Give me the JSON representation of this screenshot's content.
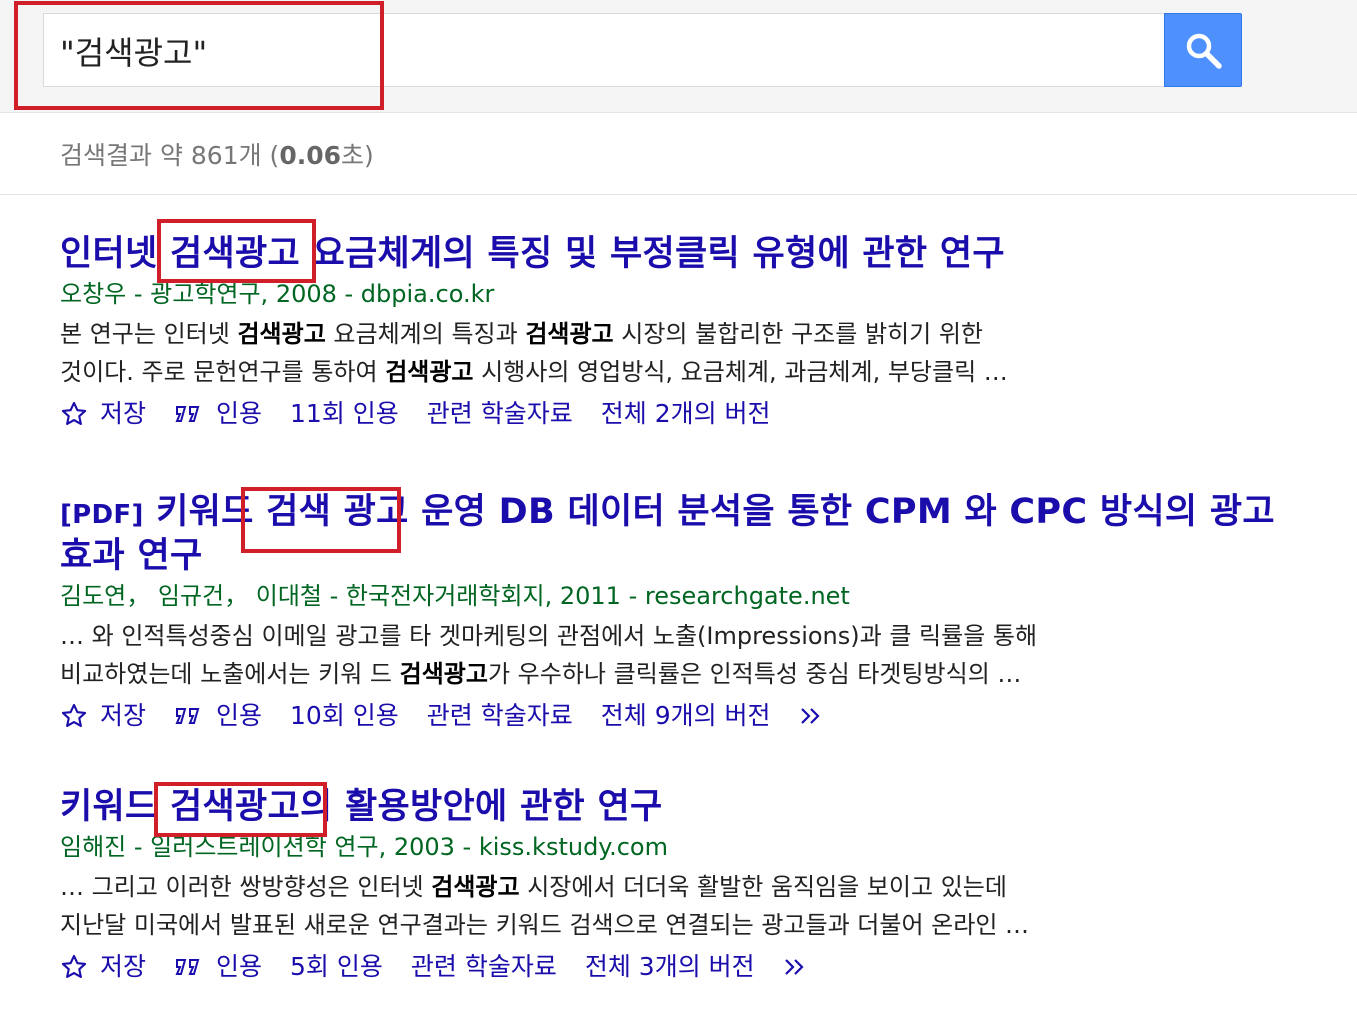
{
  "search": {
    "query": "\"검색광고\"",
    "button_icon": "search-icon"
  },
  "stats": {
    "prefix": "검색결과 약 861개 (",
    "time": "0.06",
    "suffix": "초)"
  },
  "colors": {
    "title": "#1a0dab",
    "meta": "#006621",
    "highlight_box": "#d01f28",
    "search_button": "#4d90fe"
  },
  "results": [
    {
      "title_pre": "인터넷 ",
      "title_bold": "검색광고",
      "title_post": " 요금체계의 특징 및 부정클릭 유형에 관한 연구",
      "meta": "오창우 - 광고학연구, 2008 - dbpia.co.kr",
      "snippet_line1_a": "본 연구는 인터넷 ",
      "snippet_line1_b": "검색광고",
      "snippet_line1_c": " 요금체계의 특징과 ",
      "snippet_line1_d": "검색광고",
      "snippet_line1_e": " 시장의 불합리한 구조를 밝히기 위한",
      "snippet_line2_a": "것이다. 주로 문헌연구를 통하여 ",
      "snippet_line2_b": "검색광고",
      "snippet_line2_c": " 시행사의 영업방식, 요금체계, 과금체계, 부당클릭 …",
      "save": "저장",
      "cite": "인용",
      "cited_by": "11회 인용",
      "related": "관련 학술자료",
      "versions": "전체 2개의 버전"
    },
    {
      "pdf_tag": "[PDF]",
      "title_pre": " 키워드 ",
      "title_bold": "검색 광고",
      "title_post": " 운영 DB 데이터 분석을 통한 CPM 와 CPC 방식의 광고효과 연구",
      "meta": "김도연， 임규건， 이대철 - 한국전자거래학회지, 2011 - researchgate.net",
      "snippet_line1": "… 와 인적특성중심 이메일 광고를 타 겟마케팅의 관점에서 노출(Impressions)과 클 릭률을 통해",
      "snippet_line2_a": "비교하였는데 노출에서는 키워 드 ",
      "snippet_line2_b": "검색광고",
      "snippet_line2_c": "가 우수하나 클릭률은 인적특성 중심 타겟팅방식의 …",
      "save": "저장",
      "cite": "인용",
      "cited_by": "10회 인용",
      "related": "관련 학술자료",
      "versions": "전체 9개의 버전"
    },
    {
      "title_pre": "키워드 ",
      "title_bold": "검색광고",
      "title_post": "의 활용방안에 관한 연구",
      "meta": "임해진 - 일러스트레이션학 연구, 2003 - kiss.kstudy.com",
      "snippet_line1_a": "… 그리고 이러한 쌍방향성은 인터넷 ",
      "snippet_line1_b": "검색광고",
      "snippet_line1_c": " 시장에서 더더욱 활발한 움직임을 보이고 있는데",
      "snippet_line2": "지난달 미국에서 발표된 새로운 연구결과는 키워드 검색으로 연결되는 광고들과 더불어 온라인 …",
      "save": "저장",
      "cite": "인용",
      "cited_by": "5회 인용",
      "related": "관련 학술자료",
      "versions": "전체 3개의 버전"
    }
  ]
}
